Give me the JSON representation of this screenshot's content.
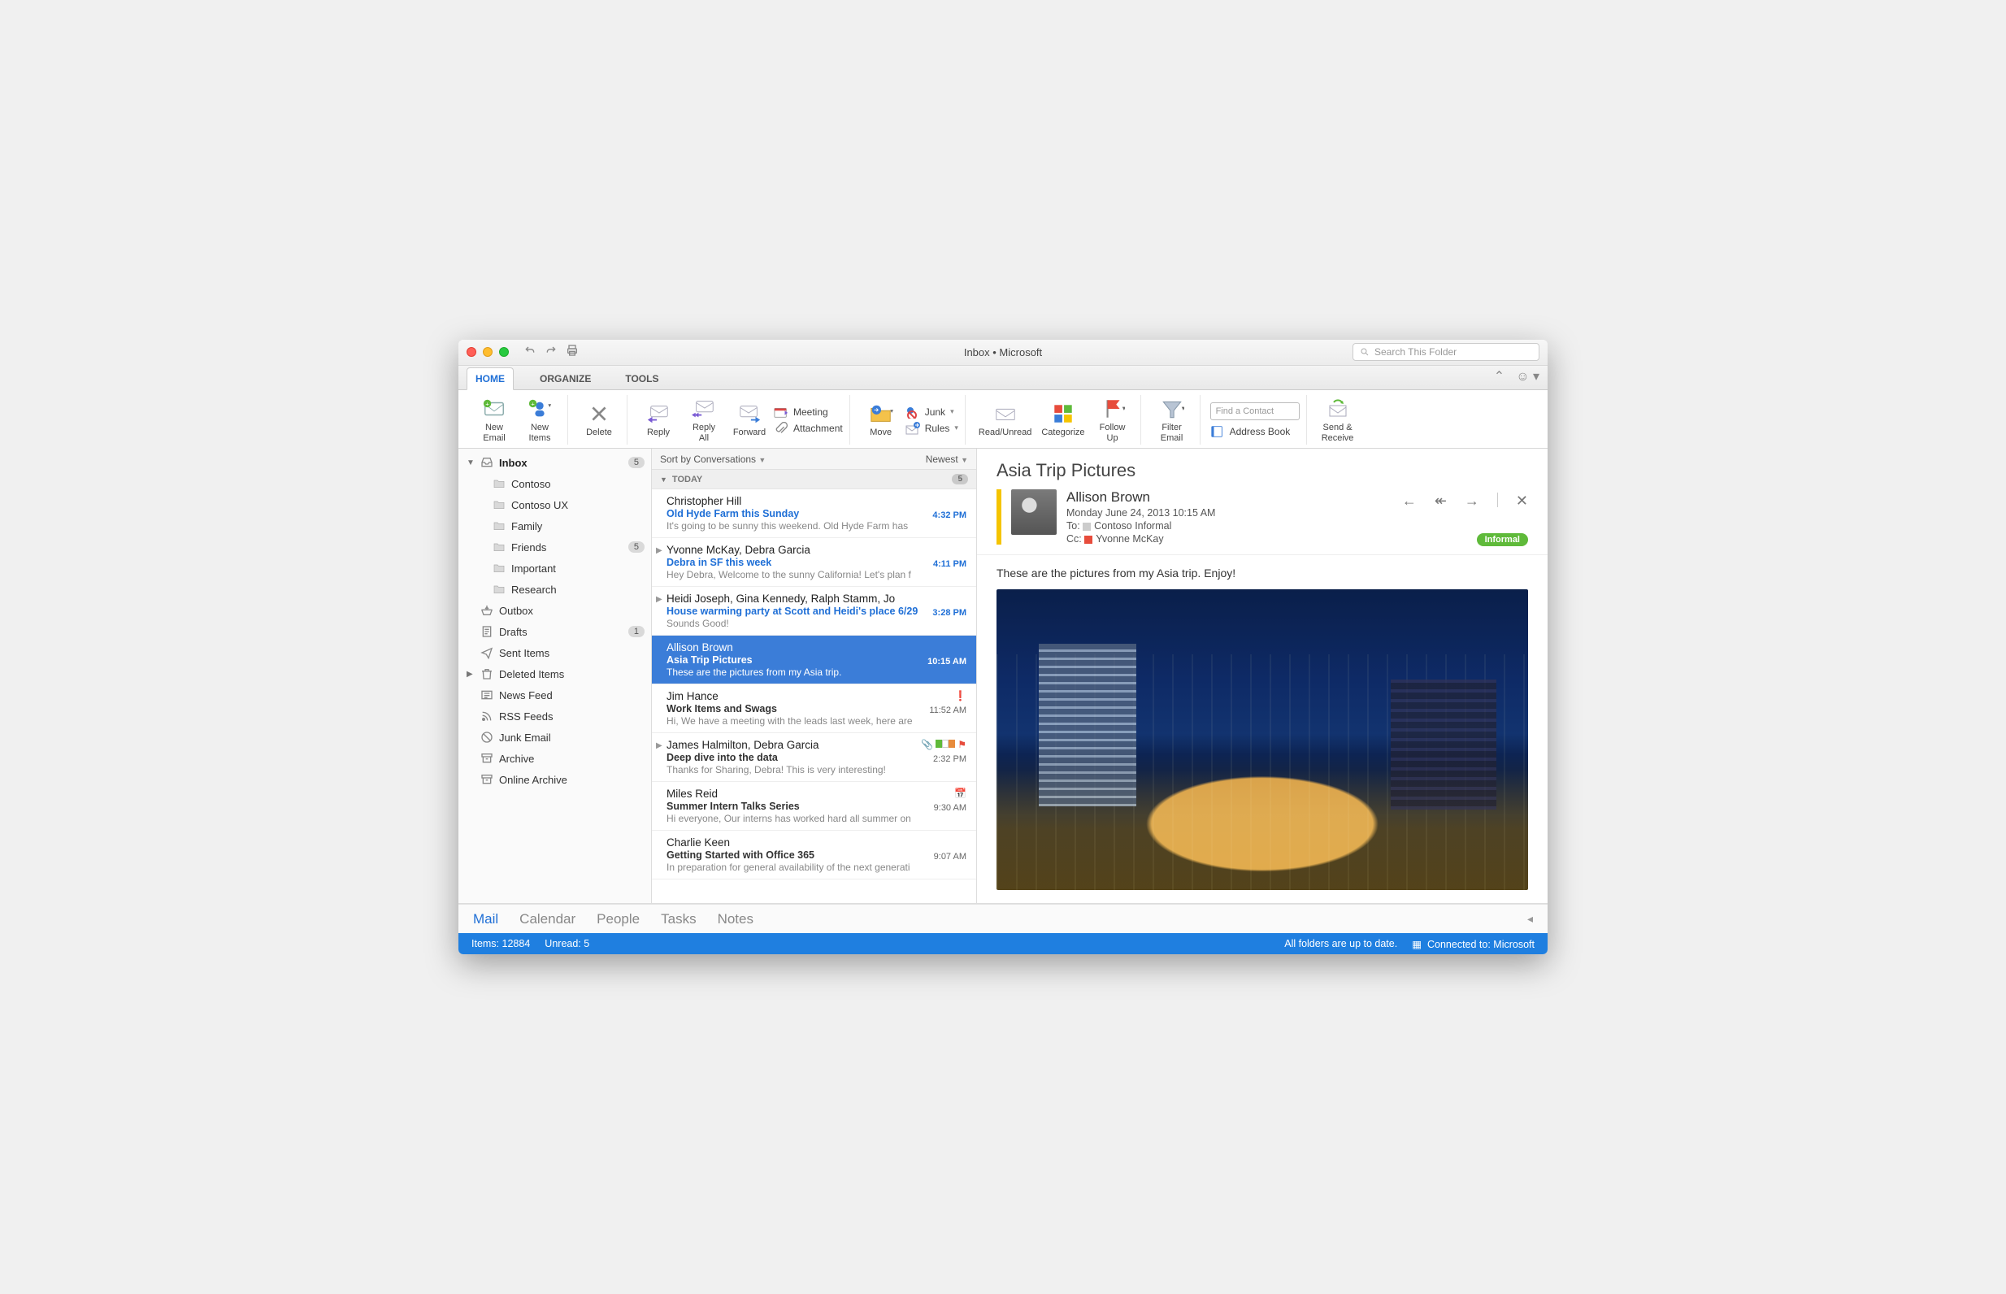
{
  "window_title": "Inbox • Microsoft",
  "search_placeholder": "Search This Folder",
  "tabs": {
    "home": "HOME",
    "organize": "ORGANIZE",
    "tools": "TOOLS"
  },
  "ribbon": {
    "new_email": "New\nEmail",
    "new_items": "New\nItems",
    "delete": "Delete",
    "reply": "Reply",
    "reply_all": "Reply\nAll",
    "forward": "Forward",
    "meeting": "Meeting",
    "attachment": "Attachment",
    "move": "Move",
    "junk": "Junk",
    "rules": "Rules",
    "read_unread": "Read/Unread",
    "categorize": "Categorize",
    "follow_up": "Follow\nUp",
    "filter_email": "Filter\nEmail",
    "find_contact_placeholder": "Find a Contact",
    "address_book": "Address Book",
    "send_receive": "Send &\nReceive"
  },
  "folders": [
    {
      "name": "Inbox",
      "badge": "5",
      "bold": true,
      "expandable": true,
      "expanded": true,
      "icon": "inbox"
    },
    {
      "name": "Contoso",
      "sub": true,
      "icon": "folder"
    },
    {
      "name": "Contoso UX",
      "sub": true,
      "icon": "folder"
    },
    {
      "name": "Family",
      "sub": true,
      "icon": "folder"
    },
    {
      "name": "Friends",
      "sub": true,
      "badge": "5",
      "icon": "folder"
    },
    {
      "name": "Important",
      "sub": true,
      "icon": "folder"
    },
    {
      "name": "Research",
      "sub": true,
      "icon": "folder"
    },
    {
      "name": "Outbox",
      "icon": "outbox"
    },
    {
      "name": "Drafts",
      "badge": "1",
      "icon": "drafts"
    },
    {
      "name": "Sent Items",
      "icon": "sent"
    },
    {
      "name": "Deleted Items",
      "icon": "trash",
      "expandable": true
    },
    {
      "name": "News Feed",
      "icon": "news"
    },
    {
      "name": "RSS Feeds",
      "icon": "rss"
    },
    {
      "name": "Junk Email",
      "icon": "junk"
    },
    {
      "name": "Archive",
      "icon": "archive"
    },
    {
      "name": "Online Archive",
      "icon": "archive"
    }
  ],
  "msglist": {
    "sort_label": "Sort by Conversations",
    "order_label": "Newest",
    "group_label": "TODAY",
    "group_badge": "5",
    "items": [
      {
        "from": "Christopher Hill",
        "subject": "Old Hyde Farm this Sunday",
        "preview": "It's going to be sunny this weekend. Old Hyde Farm has",
        "time": "4:32 PM",
        "unread": true
      },
      {
        "from": "Yvonne McKay, Debra Garcia",
        "subject": "Debra in SF this week",
        "preview": "Hey Debra, Welcome to the sunny California! Let's plan f",
        "time": "4:11 PM",
        "unread": true,
        "thread": true
      },
      {
        "from": "Heidi Joseph, Gina Kennedy, Ralph Stamm, Jo",
        "subject": "House warming party at Scott and Heidi's place 6/29",
        "preview": "Sounds Good!",
        "time": "3:28 PM",
        "unread": true,
        "thread": true
      },
      {
        "from": "Allison Brown",
        "subject": "Asia Trip Pictures",
        "preview": "These are the pictures from my Asia trip.",
        "time": "10:15 AM",
        "selected": true
      },
      {
        "from": "Jim Hance",
        "subject": "Work Items and Swags",
        "preview": "Hi, We have a meeting with the leads last week, here are",
        "time": "11:52 AM",
        "read": true,
        "important": true
      },
      {
        "from": "James Halmilton, Debra Garcia",
        "subject": "Deep dive into the data",
        "preview": "Thanks for Sharing, Debra! This is very interesting!",
        "time": "2:32 PM",
        "read": true,
        "thread": true,
        "attach": true,
        "flags": true
      },
      {
        "from": "Miles Reid",
        "subject": "Summer Intern Talks Series",
        "preview": "Hi everyone, Our interns has worked hard all summer on",
        "time": "9:30 AM",
        "read": true,
        "calendar": true
      },
      {
        "from": "Charlie Keen",
        "subject": "Getting Started with Office 365",
        "preview": "In preparation for general availability of the next generati",
        "time": "9:07 AM",
        "read": true
      }
    ]
  },
  "reading": {
    "subject": "Asia Trip Pictures",
    "sender": "Allison Brown",
    "date": "Monday June 24, 2013 10:15 AM",
    "to_label": "To:",
    "to_value": "Contoso Informal",
    "cc_label": "Cc:",
    "cc_value": "Yvonne McKay",
    "tag": "Informal",
    "body": "These are the pictures from my Asia trip.   Enjoy!"
  },
  "nav": {
    "mail": "Mail",
    "calendar": "Calendar",
    "people": "People",
    "tasks": "Tasks",
    "notes": "Notes"
  },
  "status": {
    "items_label": "Items:",
    "items_value": "12884",
    "unread_label": "Unread:",
    "unread_value": "5",
    "sync_msg": "All folders are up to date.",
    "connection": "Connected to: Microsoft"
  }
}
